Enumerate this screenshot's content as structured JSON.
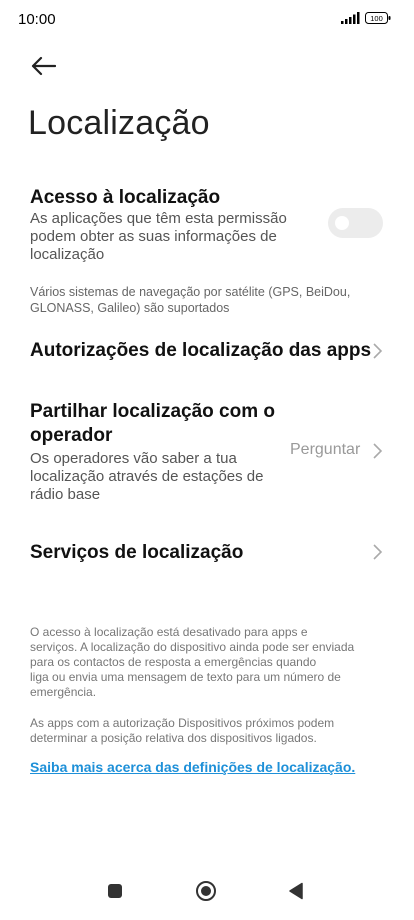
{
  "status_bar": {
    "time": "10:00",
    "battery": "100"
  },
  "page": {
    "title": "Localização"
  },
  "location_access": {
    "title": "Acesso à localização",
    "description_lines": [
      "As aplicações que têm esta permissão",
      "podem obter as suas informações de",
      "localização"
    ],
    "enabled": false,
    "note_lines": [
      "Vários sistemas de navegação por satélite (GPS, BeiDou,",
      "GLONASS, Galileo) são suportados"
    ]
  },
  "app_permissions": {
    "title": "Autorizações de localização das apps"
  },
  "share_with_carrier": {
    "title_lines": [
      "Partilhar localização com o",
      "operador"
    ],
    "description_lines": [
      "Os operadores vão saber a tua",
      "localização através de estações de",
      "rádio base"
    ],
    "value": "Perguntar"
  },
  "location_services": {
    "title": "Serviços de localização"
  },
  "footer": {
    "paragraph1_lines": [
      "O acesso à localização está desativado para apps e",
      "serviços. A localização do dispositivo ainda pode ser enviada",
      "para os contactos de resposta a emergências quando",
      "liga ou envia uma mensagem de texto para um número de",
      "emergência."
    ],
    "paragraph2_lines": [
      "As apps com a autorização Dispositivos próximos podem",
      "determinar a posição relativa dos dispositivos ligados."
    ],
    "link": "Saiba mais acerca das definições de localização."
  },
  "nav_bar": {
    "icons": [
      "recents-square-icon",
      "home-circle-icon",
      "back-triangle-icon"
    ]
  },
  "colors": {
    "link": "#1e90d8",
    "toggle_off": "#ececec"
  }
}
